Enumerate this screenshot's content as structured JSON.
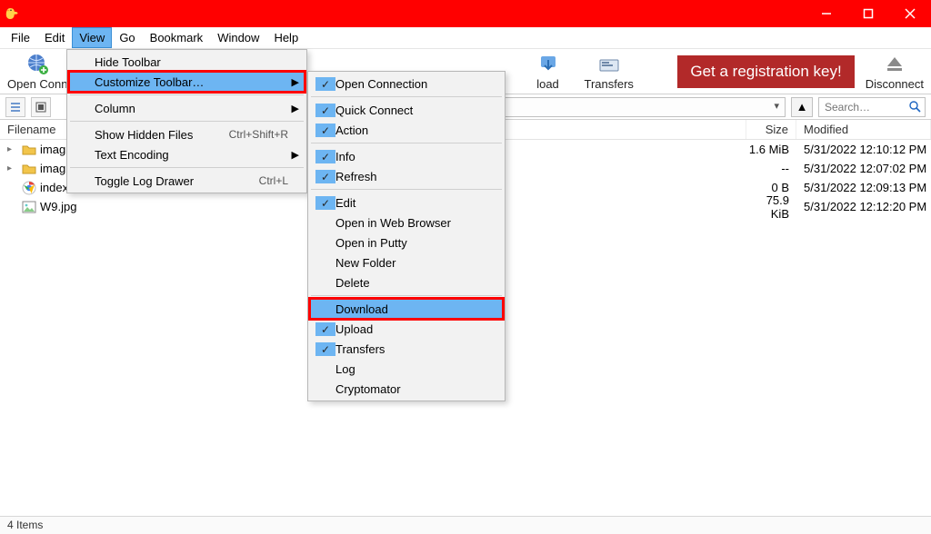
{
  "titlebar": {
    "app": "Cyberduck"
  },
  "menubar": {
    "items": [
      "File",
      "Edit",
      "View",
      "Go",
      "Bookmark",
      "Window",
      "Help"
    ],
    "active_index": 2
  },
  "toolbar": {
    "open_connection": "Open Conn",
    "download_tail": "load",
    "transfers": "Transfers",
    "disconnect": "Disconnect",
    "reg_key": "Get a registration key!"
  },
  "navrow": {
    "search_placeholder": "Search…"
  },
  "columns": {
    "filename": "Filename",
    "size": "Size",
    "modified": "Modified"
  },
  "files": [
    {
      "name": "imag",
      "kind": "folder",
      "expandable": true,
      "size": "1.6 MiB",
      "modified": "5/31/2022 12:10:12 PM"
    },
    {
      "name": "imag",
      "kind": "folder",
      "expandable": true,
      "size": "--",
      "modified": "5/31/2022 12:07:02 PM"
    },
    {
      "name": "index.html",
      "kind": "html",
      "expandable": false,
      "size": "0 B",
      "modified": "5/31/2022 12:09:13 PM"
    },
    {
      "name": "W9.jpg",
      "kind": "image",
      "expandable": false,
      "size": "75.9 KiB",
      "modified": "5/31/2022 12:12:20 PM"
    }
  ],
  "status": "4 Items",
  "view_menu": [
    {
      "label": "Hide Toolbar"
    },
    {
      "label": "Customize Toolbar…",
      "highlight": "boxed",
      "submenu": true
    },
    {
      "sep": true
    },
    {
      "label": "Column",
      "submenu": true
    },
    {
      "sep": true
    },
    {
      "label": "Show Hidden Files",
      "accel": "Ctrl+Shift+R"
    },
    {
      "label": "Text Encoding",
      "submenu": true
    },
    {
      "sep": true
    },
    {
      "label": "Toggle Log Drawer",
      "accel": "Ctrl+L"
    }
  ],
  "customize_submenu": [
    {
      "label": "Open Connection",
      "checked": true
    },
    {
      "sep": true
    },
    {
      "label": "Quick Connect",
      "checked": true
    },
    {
      "label": "Action",
      "checked": true
    },
    {
      "sep": true
    },
    {
      "label": "Info",
      "checked": true
    },
    {
      "label": "Refresh",
      "checked": true
    },
    {
      "sep": true
    },
    {
      "label": "Edit",
      "checked": true
    },
    {
      "label": "Open in Web Browser"
    },
    {
      "label": "Open in Putty"
    },
    {
      "label": "New Folder"
    },
    {
      "label": "Delete"
    },
    {
      "sep": true
    },
    {
      "label": "Download",
      "highlight": "boxed"
    },
    {
      "label": "Upload",
      "checked": true
    },
    {
      "label": "Transfers",
      "checked": true
    },
    {
      "label": "Log"
    },
    {
      "label": "Cryptomator"
    }
  ]
}
